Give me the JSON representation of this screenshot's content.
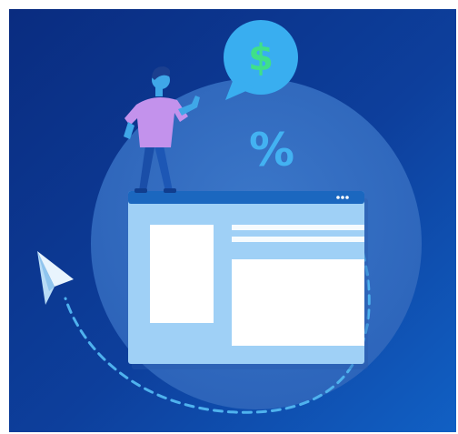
{
  "illustration": {
    "currency_symbol": "$",
    "percent_symbol": "%",
    "icons": {
      "person": "person-icon",
      "speech_bubble": "speech-bubble-icon",
      "browser_window": "browser-window-icon",
      "paper_plane": "paper-plane-icon"
    },
    "colors": {
      "background_dark": "#0b2f86",
      "background_light": "#0f51b5",
      "circle": "#3a76c8",
      "bubble": "#39aef0",
      "dollar": "#3fe089",
      "percent": "#43b2f2",
      "window_frame": "#1b67bf",
      "window_body": "#9fd0f6",
      "panel": "#ffffff",
      "shirt": "#c392ec",
      "dashed_path": "#4fb2ee"
    }
  }
}
